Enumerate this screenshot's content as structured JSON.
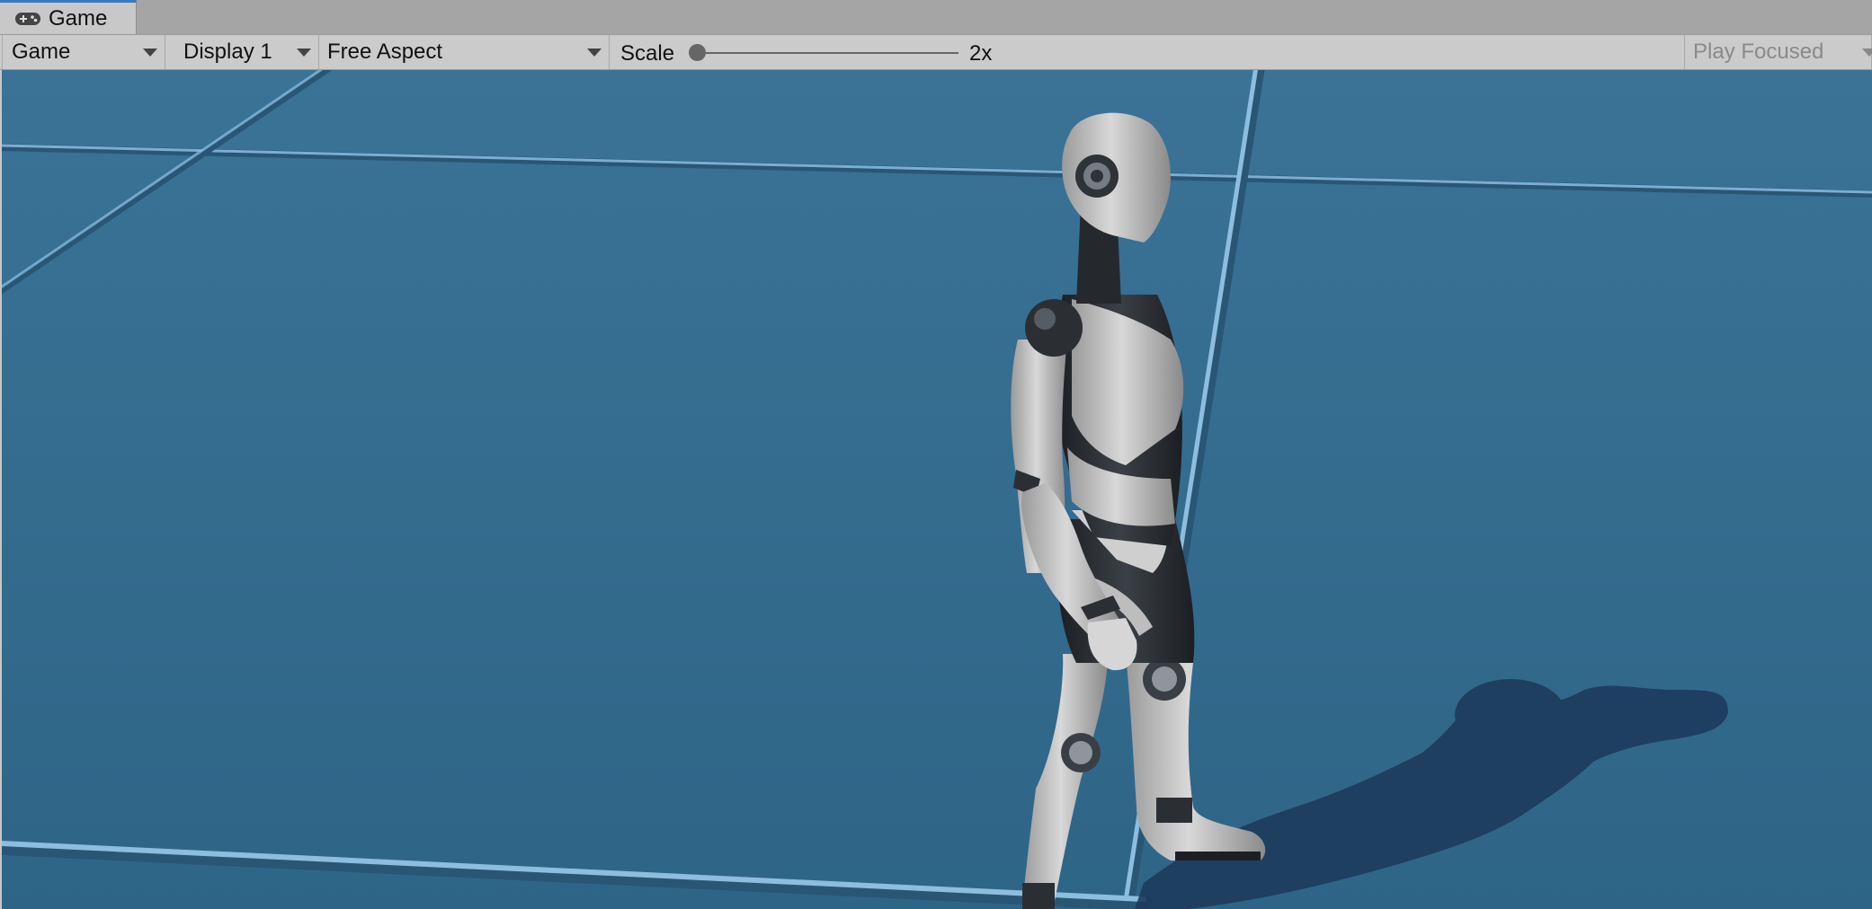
{
  "tab": {
    "label": "Game",
    "icon": "gamepad-icon"
  },
  "toolbar": {
    "view_select": "Game",
    "display_select": "Display 1",
    "aspect_select": "Free Aspect",
    "scale_label": "Scale",
    "scale_value": "2x",
    "scale_slider_level": 0.0,
    "play_mode_select": "Play Focused"
  },
  "viewport": {
    "floor_color": "#336b8e",
    "grid_line_color": "#8ec4ea",
    "shadow_color": "#1d3b5c",
    "character": "robot-character"
  }
}
